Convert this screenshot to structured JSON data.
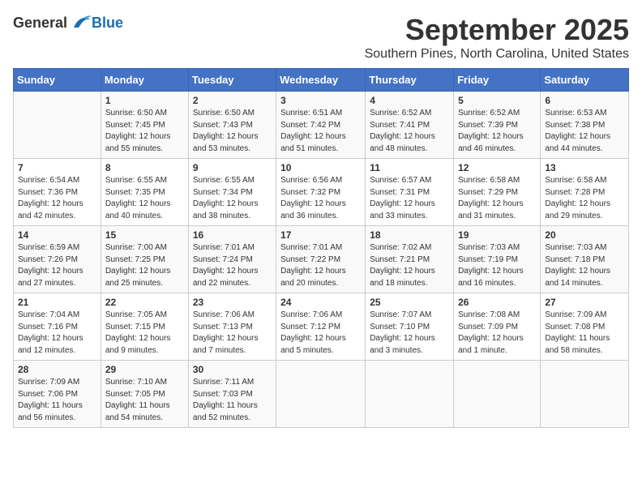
{
  "logo": {
    "general": "General",
    "blue": "Blue"
  },
  "header": {
    "month": "September 2025",
    "location": "Southern Pines, North Carolina, United States"
  },
  "weekdays": [
    "Sunday",
    "Monday",
    "Tuesday",
    "Wednesday",
    "Thursday",
    "Friday",
    "Saturday"
  ],
  "weeks": [
    [
      {
        "day": "",
        "info": ""
      },
      {
        "day": "1",
        "info": "Sunrise: 6:50 AM\nSunset: 7:45 PM\nDaylight: 12 hours\nand 55 minutes."
      },
      {
        "day": "2",
        "info": "Sunrise: 6:50 AM\nSunset: 7:43 PM\nDaylight: 12 hours\nand 53 minutes."
      },
      {
        "day": "3",
        "info": "Sunrise: 6:51 AM\nSunset: 7:42 PM\nDaylight: 12 hours\nand 51 minutes."
      },
      {
        "day": "4",
        "info": "Sunrise: 6:52 AM\nSunset: 7:41 PM\nDaylight: 12 hours\nand 48 minutes."
      },
      {
        "day": "5",
        "info": "Sunrise: 6:52 AM\nSunset: 7:39 PM\nDaylight: 12 hours\nand 46 minutes."
      },
      {
        "day": "6",
        "info": "Sunrise: 6:53 AM\nSunset: 7:38 PM\nDaylight: 12 hours\nand 44 minutes."
      }
    ],
    [
      {
        "day": "7",
        "info": "Sunrise: 6:54 AM\nSunset: 7:36 PM\nDaylight: 12 hours\nand 42 minutes."
      },
      {
        "day": "8",
        "info": "Sunrise: 6:55 AM\nSunset: 7:35 PM\nDaylight: 12 hours\nand 40 minutes."
      },
      {
        "day": "9",
        "info": "Sunrise: 6:55 AM\nSunset: 7:34 PM\nDaylight: 12 hours\nand 38 minutes."
      },
      {
        "day": "10",
        "info": "Sunrise: 6:56 AM\nSunset: 7:32 PM\nDaylight: 12 hours\nand 36 minutes."
      },
      {
        "day": "11",
        "info": "Sunrise: 6:57 AM\nSunset: 7:31 PM\nDaylight: 12 hours\nand 33 minutes."
      },
      {
        "day": "12",
        "info": "Sunrise: 6:58 AM\nSunset: 7:29 PM\nDaylight: 12 hours\nand 31 minutes."
      },
      {
        "day": "13",
        "info": "Sunrise: 6:58 AM\nSunset: 7:28 PM\nDaylight: 12 hours\nand 29 minutes."
      }
    ],
    [
      {
        "day": "14",
        "info": "Sunrise: 6:59 AM\nSunset: 7:26 PM\nDaylight: 12 hours\nand 27 minutes."
      },
      {
        "day": "15",
        "info": "Sunrise: 7:00 AM\nSunset: 7:25 PM\nDaylight: 12 hours\nand 25 minutes."
      },
      {
        "day": "16",
        "info": "Sunrise: 7:01 AM\nSunset: 7:24 PM\nDaylight: 12 hours\nand 22 minutes."
      },
      {
        "day": "17",
        "info": "Sunrise: 7:01 AM\nSunset: 7:22 PM\nDaylight: 12 hours\nand 20 minutes."
      },
      {
        "day": "18",
        "info": "Sunrise: 7:02 AM\nSunset: 7:21 PM\nDaylight: 12 hours\nand 18 minutes."
      },
      {
        "day": "19",
        "info": "Sunrise: 7:03 AM\nSunset: 7:19 PM\nDaylight: 12 hours\nand 16 minutes."
      },
      {
        "day": "20",
        "info": "Sunrise: 7:03 AM\nSunset: 7:18 PM\nDaylight: 12 hours\nand 14 minutes."
      }
    ],
    [
      {
        "day": "21",
        "info": "Sunrise: 7:04 AM\nSunset: 7:16 PM\nDaylight: 12 hours\nand 12 minutes."
      },
      {
        "day": "22",
        "info": "Sunrise: 7:05 AM\nSunset: 7:15 PM\nDaylight: 12 hours\nand 9 minutes."
      },
      {
        "day": "23",
        "info": "Sunrise: 7:06 AM\nSunset: 7:13 PM\nDaylight: 12 hours\nand 7 minutes."
      },
      {
        "day": "24",
        "info": "Sunrise: 7:06 AM\nSunset: 7:12 PM\nDaylight: 12 hours\nand 5 minutes."
      },
      {
        "day": "25",
        "info": "Sunrise: 7:07 AM\nSunset: 7:10 PM\nDaylight: 12 hours\nand 3 minutes."
      },
      {
        "day": "26",
        "info": "Sunrise: 7:08 AM\nSunset: 7:09 PM\nDaylight: 12 hours\nand 1 minute."
      },
      {
        "day": "27",
        "info": "Sunrise: 7:09 AM\nSunset: 7:08 PM\nDaylight: 11 hours\nand 58 minutes."
      }
    ],
    [
      {
        "day": "28",
        "info": "Sunrise: 7:09 AM\nSunset: 7:06 PM\nDaylight: 11 hours\nand 56 minutes."
      },
      {
        "day": "29",
        "info": "Sunrise: 7:10 AM\nSunset: 7:05 PM\nDaylight: 11 hours\nand 54 minutes."
      },
      {
        "day": "30",
        "info": "Sunrise: 7:11 AM\nSunset: 7:03 PM\nDaylight: 11 hours\nand 52 minutes."
      },
      {
        "day": "",
        "info": ""
      },
      {
        "day": "",
        "info": ""
      },
      {
        "day": "",
        "info": ""
      },
      {
        "day": "",
        "info": ""
      }
    ]
  ]
}
